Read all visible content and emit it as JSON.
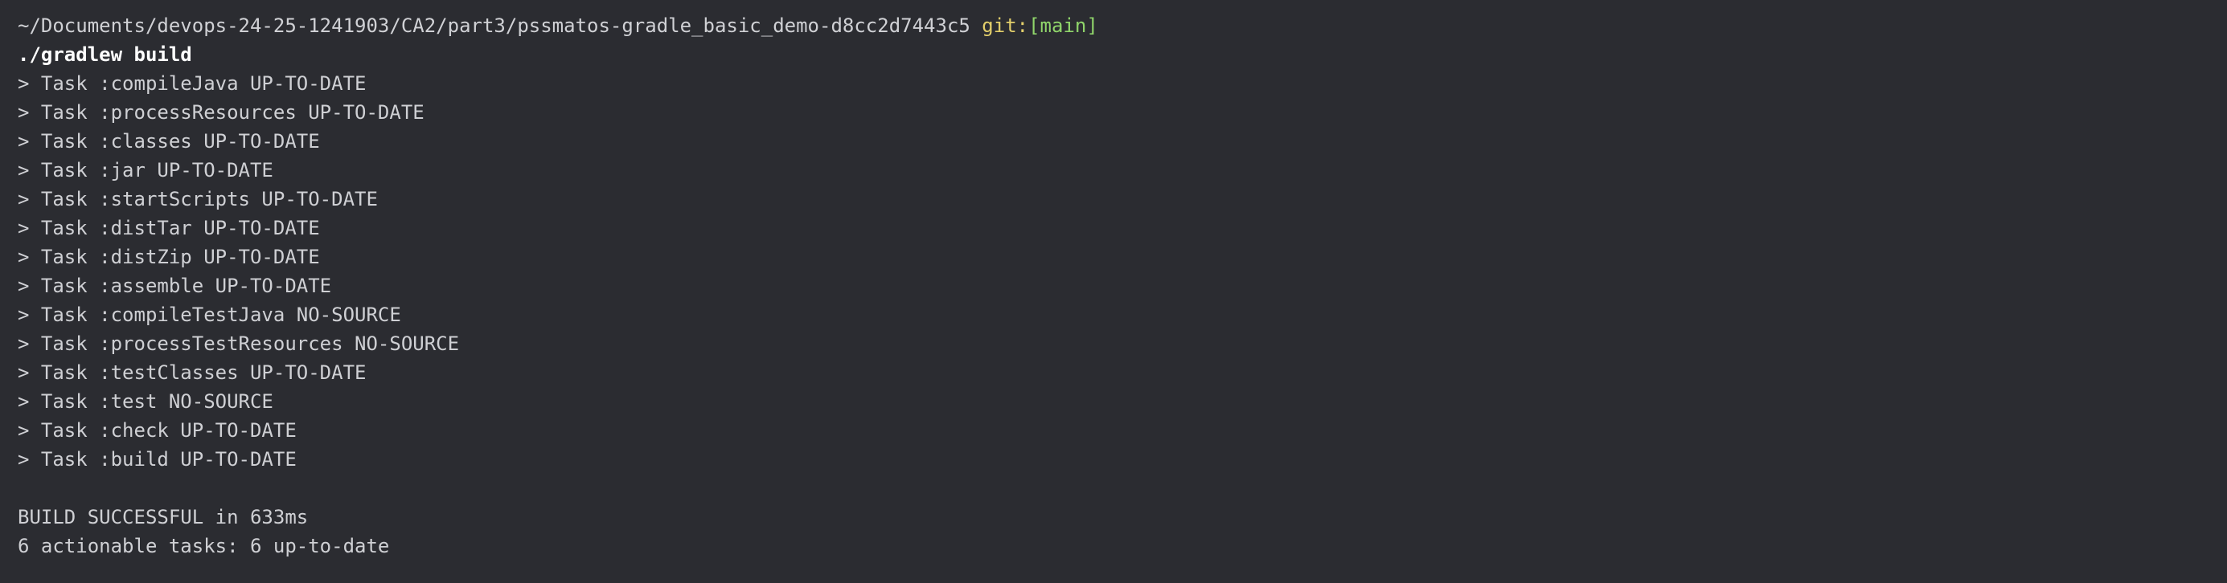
{
  "prompt": {
    "path": "~/Documents/devops-24-25-1241903/CA2/part3/pssmatos-gradle_basic_demo-d8cc2d7443c5",
    "git_label": "git:",
    "branch": "[main]"
  },
  "command": "./gradlew build",
  "tasks": [
    "> Task :compileJava UP-TO-DATE",
    "> Task :processResources UP-TO-DATE",
    "> Task :classes UP-TO-DATE",
    "> Task :jar UP-TO-DATE",
    "> Task :startScripts UP-TO-DATE",
    "> Task :distTar UP-TO-DATE",
    "> Task :distZip UP-TO-DATE",
    "> Task :assemble UP-TO-DATE",
    "> Task :compileTestJava NO-SOURCE",
    "> Task :processTestResources NO-SOURCE",
    "> Task :testClasses UP-TO-DATE",
    "> Task :test NO-SOURCE",
    "> Task :check UP-TO-DATE",
    "> Task :build UP-TO-DATE"
  ],
  "result": {
    "status": "BUILD SUCCESSFUL in 633ms",
    "summary": "6 actionable tasks: 6 up-to-date"
  },
  "colors": {
    "background": "#2b2c31",
    "text": "#cfd0d4",
    "git_label": "#e3cf6b",
    "branch": "#8fd46a",
    "command": "#ffffff"
  }
}
